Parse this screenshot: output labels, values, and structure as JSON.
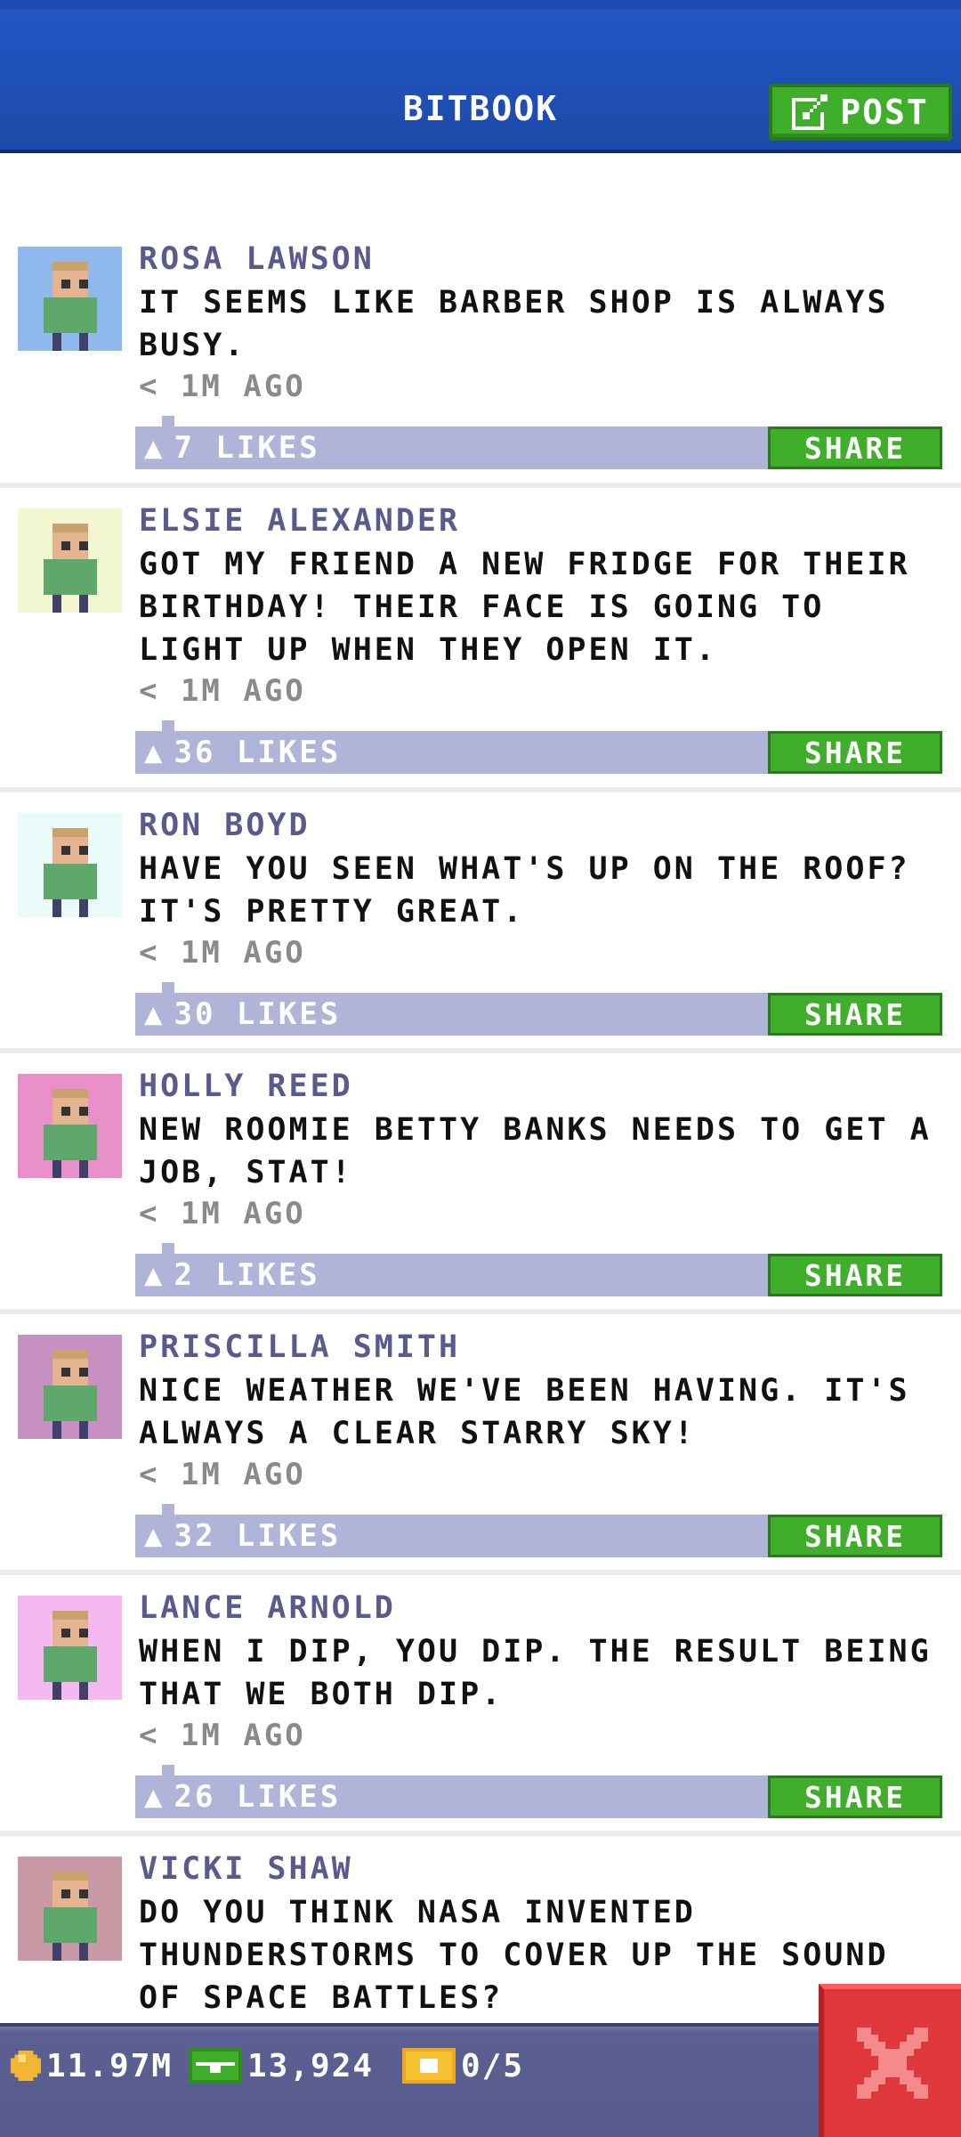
{
  "header": {
    "title": "BITBOOK",
    "post_label": "POST"
  },
  "colors": {
    "header_blue": "#2156c4",
    "share_green": "#3fae2a",
    "likes_bar": "#b0b4d8",
    "name_purple": "#5a5a8e",
    "close_red": "#e0383a"
  },
  "posts": [
    {
      "name": "ROSA LAWSON",
      "message": "IT SEEMS LIKE BARBER SHOP IS ALWAYS BUSY.",
      "time": "< 1M AGO",
      "likes": "7 LIKES",
      "share": "SHARE",
      "avatar_bg": "#8fb8ec",
      "avatar_icon": "person-avatar-icon"
    },
    {
      "name": "ELSIE ALEXANDER",
      "message": "GOT MY FRIEND A NEW FRIDGE FOR THEIR BIRTHDAY! THEIR FACE IS GOING TO LIGHT UP WHEN THEY OPEN IT.",
      "time": "< 1M AGO",
      "likes": "36 LIKES",
      "share": "SHARE",
      "avatar_bg": "#f3f7cf",
      "avatar_icon": "person-avatar-icon"
    },
    {
      "name": "RON BOYD",
      "message": "HAVE YOU SEEN WHAT'S UP ON THE ROOF? IT'S PRETTY GREAT.",
      "time": "< 1M AGO",
      "likes": "30 LIKES",
      "share": "SHARE",
      "avatar_bg": "#e9fbf8",
      "avatar_icon": "person-avatar-icon"
    },
    {
      "name": "HOLLY REED",
      "message": "NEW ROOMIE BETTY BANKS NEEDS TO GET A JOB, STAT!",
      "time": "< 1M AGO",
      "likes": "2 LIKES",
      "share": "SHARE",
      "avatar_bg": "#e98fc9",
      "avatar_icon": "person-avatar-icon"
    },
    {
      "name": "PRISCILLA SMITH",
      "message": "NICE WEATHER WE'VE BEEN HAVING. IT'S ALWAYS A CLEAR STARRY SKY!",
      "time": "< 1M AGO",
      "likes": "32 LIKES",
      "share": "SHARE",
      "avatar_bg": "#c790c3",
      "avatar_icon": "person-avatar-icon"
    },
    {
      "name": "LANCE ARNOLD",
      "message": "WHEN I DIP, YOU DIP. THE RESULT BEING THAT WE BOTH DIP.",
      "time": "< 1M AGO",
      "likes": "26 LIKES",
      "share": "SHARE",
      "avatar_bg": "#f5b8f0",
      "avatar_icon": "person-avatar-icon"
    },
    {
      "name": "VICKI SHAW",
      "message": "DO YOU THINK NASA INVENTED THUNDERSTORMS TO COVER UP THE SOUND OF SPACE BATTLES?",
      "time": "",
      "likes": "",
      "share": "",
      "avatar_bg": "#c99aa6",
      "avatar_icon": "person-avatar-icon"
    }
  ],
  "bottom_bar": {
    "coins": "11.97M",
    "bux": "13,924",
    "tickets": "0/5"
  }
}
